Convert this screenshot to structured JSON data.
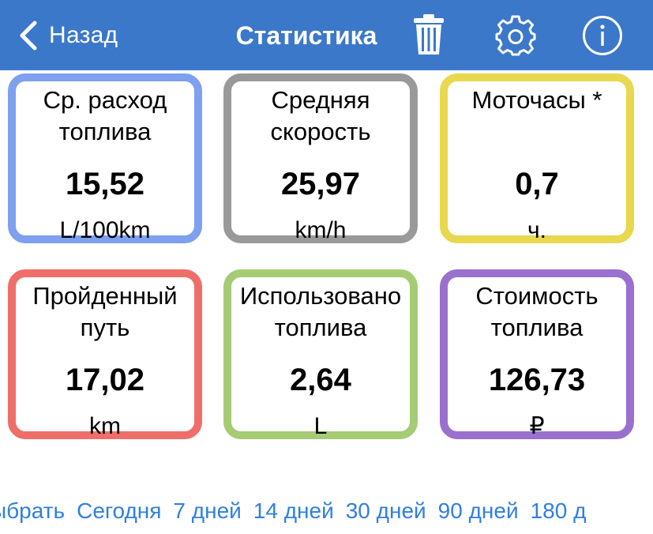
{
  "navbar": {
    "back_label": "Назад",
    "title": "Статистика",
    "icons": [
      "chevron-left-icon",
      "trash-icon",
      "gear-icon",
      "info-icon"
    ],
    "background": "#3b78c9"
  },
  "cards": [
    {
      "title": "Ср. расход\nтоплива",
      "value": "15,52",
      "unit": "L/100km",
      "color": "#7ea0ee"
    },
    {
      "title": "Средняя\nскорость",
      "value": "25,97",
      "unit": "km/h",
      "color": "#999999"
    },
    {
      "title": "Моточасы *",
      "value": "0,7",
      "unit": "ч.",
      "color": "#e8d84e"
    },
    {
      "title": "Пройденный\nпуть",
      "value": "17,02",
      "unit": "km",
      "color": "#ee6f6a"
    },
    {
      "title": "Использовано\nтоплива",
      "value": "2,64",
      "unit": "L",
      "color": "#a5cb74"
    },
    {
      "title": "Стоимость\nтоплива",
      "value": "126,73",
      "unit": "₽",
      "color": "#9a70cf"
    }
  ],
  "ranges": [
    "ыбрать",
    "Сегодня",
    "7 дней",
    "14 дней",
    "30 дней",
    "90 дней",
    "180 д"
  ],
  "accent": "#2f7fe0"
}
